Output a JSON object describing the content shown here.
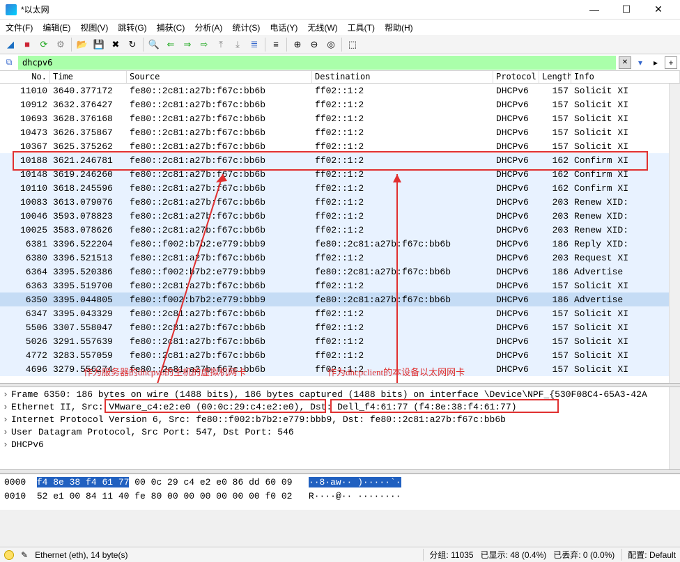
{
  "window": {
    "title": "*以太网"
  },
  "menus": [
    "文件(F)",
    "编辑(E)",
    "视图(V)",
    "跳转(G)",
    "捕获(C)",
    "分析(A)",
    "统计(S)",
    "电话(Y)",
    "无线(W)",
    "工具(T)",
    "帮助(H)"
  ],
  "filter": {
    "value": "dhcpv6"
  },
  "cols": {
    "no": "No.",
    "time": "Time",
    "src": "Source",
    "dst": "Destination",
    "proto": "Protocol",
    "len": "Length",
    "info": "Info"
  },
  "packets": [
    {
      "no": "4696",
      "time": "3279.556274",
      "src": "fe80::2c81:a27b:f67c:bb6b",
      "dst": "ff02::1:2",
      "proto": "DHCPv6",
      "len": "157",
      "info": "Solicit XI",
      "cls": "row-light"
    },
    {
      "no": "4772",
      "time": "3283.557059",
      "src": "fe80::2c81:a27b:f67c:bb6b",
      "dst": "ff02::1:2",
      "proto": "DHCPv6",
      "len": "157",
      "info": "Solicit XI",
      "cls": "row-light"
    },
    {
      "no": "5026",
      "time": "3291.557639",
      "src": "fe80::2c81:a27b:f67c:bb6b",
      "dst": "ff02::1:2",
      "proto": "DHCPv6",
      "len": "157",
      "info": "Solicit XI",
      "cls": "row-light"
    },
    {
      "no": "5506",
      "time": "3307.558047",
      "src": "fe80::2c81:a27b:f67c:bb6b",
      "dst": "ff02::1:2",
      "proto": "DHCPv6",
      "len": "157",
      "info": "Solicit XI",
      "cls": "row-light"
    },
    {
      "no": "6347",
      "time": "3395.043329",
      "src": "fe80::2c81:a27b:f67c:bb6b",
      "dst": "ff02::1:2",
      "proto": "DHCPv6",
      "len": "157",
      "info": "Solicit XI",
      "cls": "row-light"
    },
    {
      "no": "6350",
      "time": "3395.044805",
      "src": "fe80::f002:b7b2:e779:bbb9",
      "dst": "fe80::2c81:a27b:f67c:bb6b",
      "proto": "DHCPv6",
      "len": "186",
      "info": "Advertise",
      "cls": "row-sel"
    },
    {
      "no": "6363",
      "time": "3395.519700",
      "src": "fe80::2c81:a27b:f67c:bb6b",
      "dst": "ff02::1:2",
      "proto": "DHCPv6",
      "len": "157",
      "info": "Solicit XI",
      "cls": "row-light"
    },
    {
      "no": "6364",
      "time": "3395.520386",
      "src": "fe80::f002:b7b2:e779:bbb9",
      "dst": "fe80::2c81:a27b:f67c:bb6b",
      "proto": "DHCPv6",
      "len": "186",
      "info": "Advertise",
      "cls": "row-light"
    },
    {
      "no": "6380",
      "time": "3396.521513",
      "src": "fe80::2c81:a27b:f67c:bb6b",
      "dst": "ff02::1:2",
      "proto": "DHCPv6",
      "len": "203",
      "info": "Request XI",
      "cls": "row-light"
    },
    {
      "no": "6381",
      "time": "3396.522204",
      "src": "fe80::f002:b7b2:e779:bbb9",
      "dst": "fe80::2c81:a27b:f67c:bb6b",
      "proto": "DHCPv6",
      "len": "186",
      "info": "Reply XID:",
      "cls": "row-light"
    },
    {
      "no": "10025",
      "time": "3583.078626",
      "src": "fe80::2c81:a27b:f67c:bb6b",
      "dst": "ff02::1:2",
      "proto": "DHCPv6",
      "len": "203",
      "info": "Renew XID:",
      "cls": "row-light"
    },
    {
      "no": "10046",
      "time": "3593.078823",
      "src": "fe80::2c81:a27b:f67c:bb6b",
      "dst": "ff02::1:2",
      "proto": "DHCPv6",
      "len": "203",
      "info": "Renew XID:",
      "cls": "row-light"
    },
    {
      "no": "10083",
      "time": "3613.079076",
      "src": "fe80::2c81:a27b:f67c:bb6b",
      "dst": "ff02::1:2",
      "proto": "DHCPv6",
      "len": "203",
      "info": "Renew XID:",
      "cls": "row-light"
    },
    {
      "no": "10110",
      "time": "3618.245596",
      "src": "fe80::2c81:a27b:f67c:bb6b",
      "dst": "ff02::1:2",
      "proto": "DHCPv6",
      "len": "162",
      "info": "Confirm XI",
      "cls": "row-light"
    },
    {
      "no": "10148",
      "time": "3619.246260",
      "src": "fe80::2c81:a27b:f67c:bb6b",
      "dst": "ff02::1:2",
      "proto": "DHCPv6",
      "len": "162",
      "info": "Confirm XI",
      "cls": "row-light"
    },
    {
      "no": "10188",
      "time": "3621.246781",
      "src": "fe80::2c81:a27b:f67c:bb6b",
      "dst": "ff02::1:2",
      "proto": "DHCPv6",
      "len": "162",
      "info": "Confirm XI",
      "cls": "row-light"
    },
    {
      "no": "10367",
      "time": "3625.375262",
      "src": "fe80::2c81:a27b:f67c:bb6b",
      "dst": "ff02::1:2",
      "proto": "DHCPv6",
      "len": "157",
      "info": "Solicit XI",
      "cls": "row-plain"
    },
    {
      "no": "10473",
      "time": "3626.375867",
      "src": "fe80::2c81:a27b:f67c:bb6b",
      "dst": "ff02::1:2",
      "proto": "DHCPv6",
      "len": "157",
      "info": "Solicit XI",
      "cls": "row-plain"
    },
    {
      "no": "10693",
      "time": "3628.376168",
      "src": "fe80::2c81:a27b:f67c:bb6b",
      "dst": "ff02::1:2",
      "proto": "DHCPv6",
      "len": "157",
      "info": "Solicit XI",
      "cls": "row-plain"
    },
    {
      "no": "10912",
      "time": "3632.376427",
      "src": "fe80::2c81:a27b:f67c:bb6b",
      "dst": "ff02::1:2",
      "proto": "DHCPv6",
      "len": "157",
      "info": "Solicit XI",
      "cls": "row-plain"
    },
    {
      "no": "11010",
      "time": "3640.377172",
      "src": "fe80::2c81:a27b:f67c:bb6b",
      "dst": "ff02::1:2",
      "proto": "DHCPv6",
      "len": "157",
      "info": "Solicit XI",
      "cls": "row-plain"
    }
  ],
  "annotations": {
    "server": "作为服务器的dhcpv6的主机的虚拟机网卡",
    "client": "作为dhcpclient的本设备以太网网卡"
  },
  "details": {
    "l1": "Frame 6350: 186 bytes on wire (1488 bits), 186 bytes captured (1488 bits) on interface \\Device\\NPF_{530F08C4-65A3-42A",
    "l2a": "Ethernet II, Src",
    "l2b": ": VMware_c4:e2:e0 (00:0c:29:c4:e2:e0), ",
    "l2c": "Dst: Dell_f4:61:77 (f4:8e:38:f4:61:77)",
    "l3": "Internet Protocol Version 6, Src: fe80::f002:b7b2:e779:bbb9, Dst: fe80::2c81:a27b:f67c:bb6b",
    "l4": "User Datagram Protocol, Src Port: 547, Dst Port: 546",
    "l5": "DHCPv6"
  },
  "hex": {
    "off0": "0000",
    "sel0": "f4 8e 38 f4 61 77",
    "rest0": " 00 0c  29 c4 e2 e0 86 dd 60 09",
    "asc0": "··8·aw··  )·····`·",
    "off1": "0010",
    "line1": "52 e1 00 84 11 40 fe 80  00 00 00 00 00 00 f0 02",
    "asc1": "R····@··  ········"
  },
  "status": {
    "field": "Ethernet (eth), 14 byte(s)",
    "pkts": "分组: 11035",
    "disp": "已显示: 48 (0.4%)",
    "drop": "已丢弃: 0 (0.0%)",
    "prof": "配置: Default"
  }
}
